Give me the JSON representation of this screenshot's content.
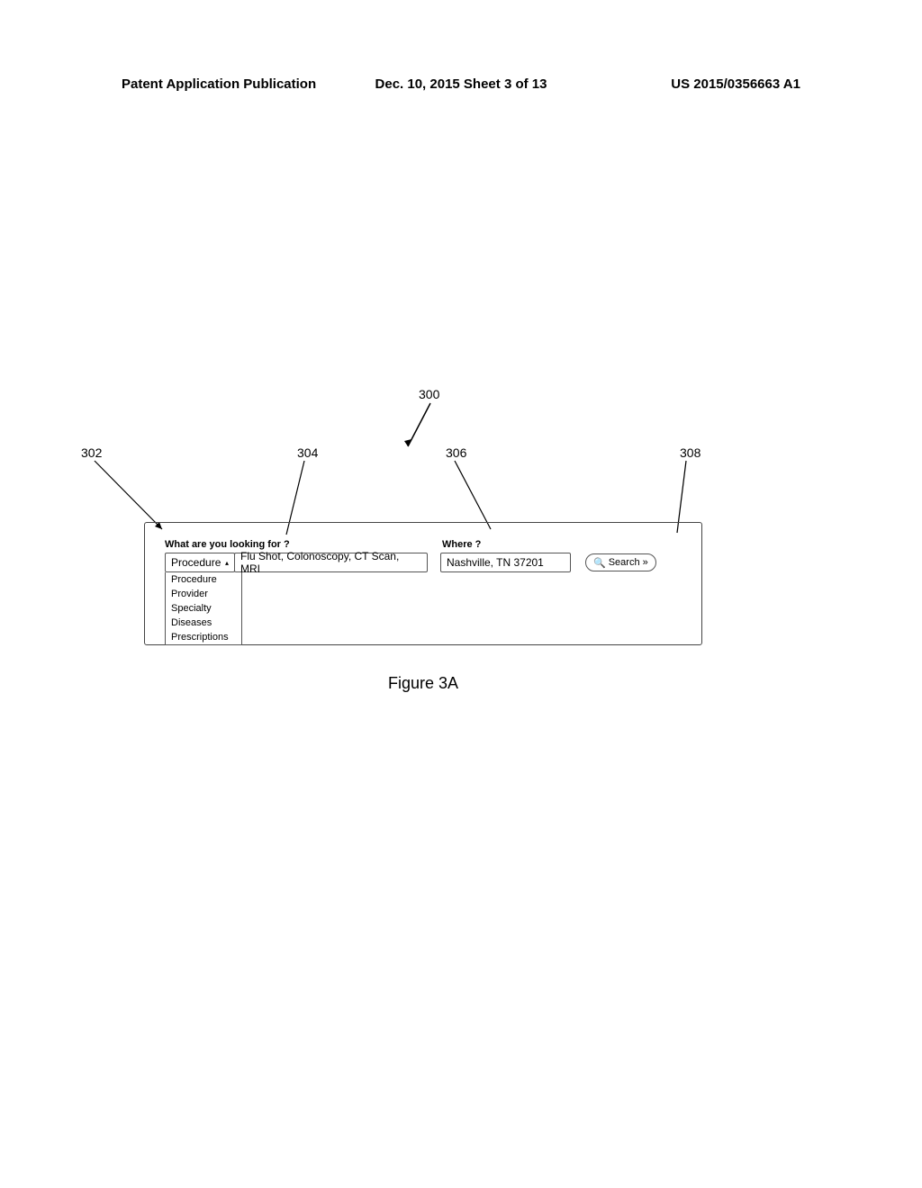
{
  "header": {
    "left": "Patent Application Publication",
    "center": "Dec. 10, 2015  Sheet 3 of 13",
    "right": "US 2015/0356663 A1"
  },
  "callouts": {
    "c300": "300",
    "c302": "302",
    "c304": "304",
    "c306": "306",
    "c308": "308"
  },
  "search_panel": {
    "label_what": "What are you looking for ?",
    "label_where": "Where ?",
    "dropdown_selected": "Procedure",
    "procedure_placeholder": "Flu Shot, Colonoscopy, CT Scan, MRI",
    "location_value": "Nashville, TN 37201",
    "search_label": "Search",
    "dropdown_options": [
      "Procedure",
      "Provider",
      "Specialty",
      "Diseases",
      "Prescriptions"
    ]
  },
  "figure_caption": "Figure 3A"
}
